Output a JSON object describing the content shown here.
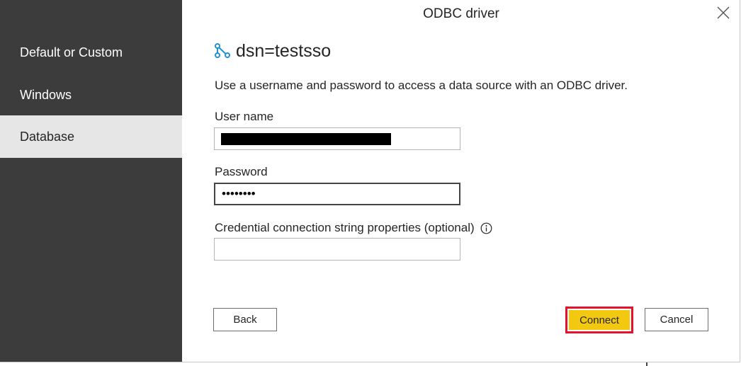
{
  "dialog": {
    "title": "ODBC driver",
    "close_icon": "close-icon"
  },
  "sidebar": {
    "items": [
      {
        "label": "Default or Custom",
        "active": false
      },
      {
        "label": "Windows",
        "active": false
      },
      {
        "label": "Database",
        "active": true
      }
    ]
  },
  "main": {
    "dsn_icon": "connection-icon",
    "dsn": "dsn=testsso",
    "description": "Use a username and password to access a data source with an ODBC driver.",
    "username": {
      "label": "User name",
      "value_redacted": true
    },
    "password": {
      "label": "Password",
      "value": "••••••••"
    },
    "credential_props": {
      "label": "Credential connection string properties (optional)",
      "info_icon": "info-icon",
      "value": ""
    }
  },
  "buttons": {
    "back": "Back",
    "connect": "Connect",
    "cancel": "Cancel"
  },
  "colors": {
    "sidebar_bg": "#3c3c3c",
    "sidebar_active_bg": "#e6e6e6",
    "connect_bg": "#f2c811",
    "highlight_border": "#e8102b",
    "icon_accent": "#1f8fd6"
  }
}
